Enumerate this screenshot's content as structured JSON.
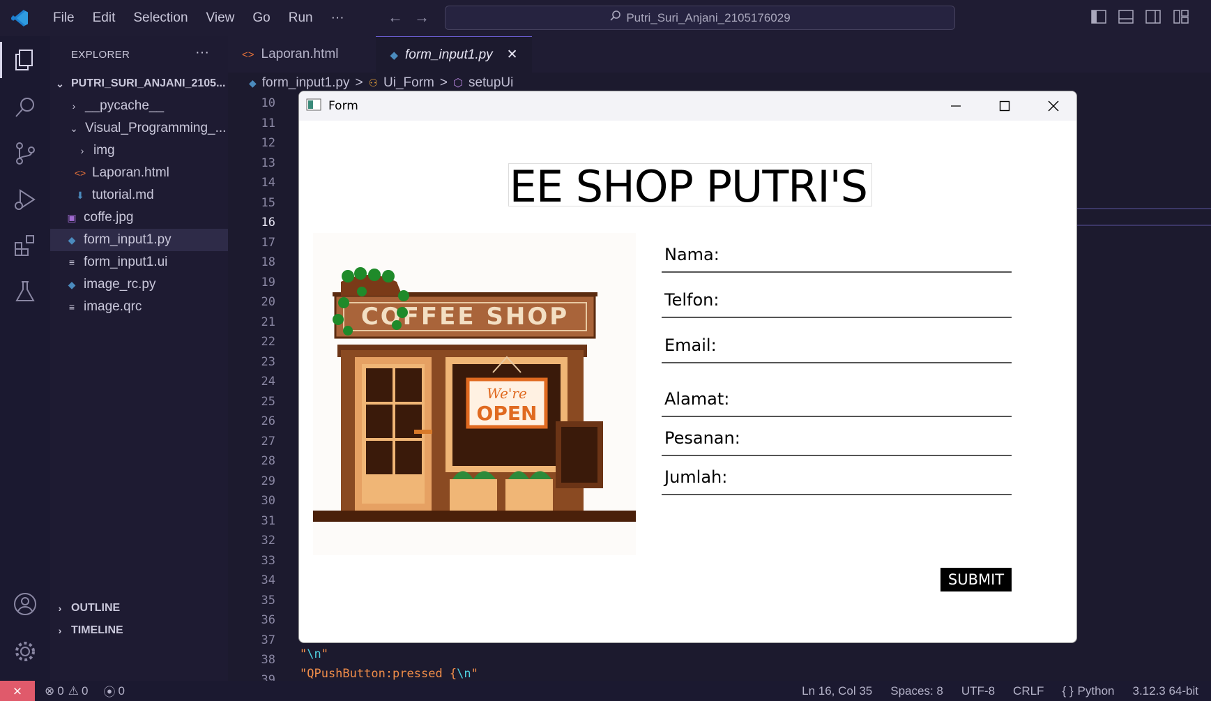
{
  "menu": [
    "File",
    "Edit",
    "Selection",
    "View",
    "Go",
    "Run",
    "···"
  ],
  "search": {
    "text": "Putri_Suri_Anjani_2105176029"
  },
  "explorer": {
    "title": "EXPLORER",
    "more": "···",
    "root": "PUTRI_SURI_ANJANI_2105...",
    "items": [
      {
        "label": "__pycache__"
      },
      {
        "label": "Visual_Programming_..."
      },
      {
        "label": "img"
      },
      {
        "label": "Laporan.html"
      },
      {
        "label": "tutorial.md"
      },
      {
        "label": "coffe.jpg"
      },
      {
        "label": "form_input1.py"
      },
      {
        "label": "form_input1.ui"
      },
      {
        "label": "image_rc.py"
      },
      {
        "label": "image.qrc"
      }
    ],
    "outline": "OUTLINE",
    "timeline": "TIMELINE"
  },
  "tabs": [
    {
      "label": "Laporan.html"
    },
    {
      "label": "form_input1.py",
      "close": "✕"
    }
  ],
  "breadcrumb": {
    "file": "form_input1.py",
    "cls": "Ui_Form",
    "method": "setupUi",
    "sep": ">"
  },
  "line_numbers": [
    "10",
    "11",
    "12",
    "13",
    "14",
    "15",
    "16",
    "17",
    "18",
    "19",
    "20",
    "21",
    "22",
    "23",
    "24",
    "25",
    "26",
    "27",
    "28",
    "29",
    "30",
    "31",
    "32",
    "33",
    "34",
    "35",
    "36",
    "37",
    "38",
    "39"
  ],
  "code": {
    "line38": {
      "q1": "\"",
      "esc": "\\n",
      "q2": "\""
    },
    "line39": {
      "pre": "\"QPushButton:pressed {",
      "esc": "\\n",
      "q2": "\""
    }
  },
  "form": {
    "title": "Form",
    "banner": "COFFEE SHOP PUTRI'S",
    "image_sign": "COFFEE SHOP",
    "image_open_small": "We're",
    "image_open_big": "OPEN",
    "fields": [
      {
        "label": "Nama:"
      },
      {
        "label": "Telfon:"
      },
      {
        "label": "Email:"
      },
      {
        "label": "Alamat:"
      },
      {
        "label": "Pesanan:"
      },
      {
        "label": "Jumlah:"
      }
    ],
    "submit": "SUBMIT"
  },
  "status": {
    "errors": "0",
    "warnings": "0",
    "ports": "0",
    "position": "Ln 16, Col 35",
    "spaces": "Spaces: 8",
    "encoding": "UTF-8",
    "eol": "CRLF",
    "language": "Python",
    "interpreter": "3.12.3 64-bit"
  },
  "colors": {
    "accent": "#6d5fd6",
    "remote": "#e05a6b",
    "python": "#4b8bbe",
    "html": "#e8733a"
  }
}
